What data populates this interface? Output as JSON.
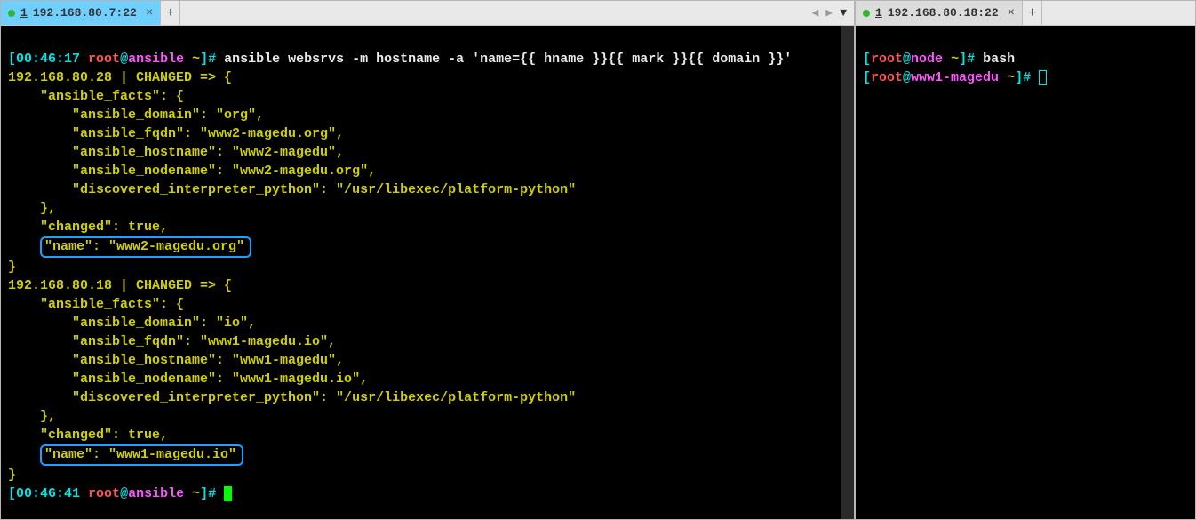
{
  "left_tab": {
    "index": "1",
    "ip": "192.168.80.7:22"
  },
  "right_tab": {
    "index": "1",
    "ip": "192.168.80.18:22"
  },
  "left": {
    "prompt1_time": "00:46:17",
    "prompt1_user": "root",
    "prompt1_at": "@",
    "prompt1_host": "ansible",
    "prompt1_path": " ~",
    "prompt1_close": "]#",
    "command": " ansible websrvs -m hostname -a 'name={{ hname }}{{ mark }}{{ domain }}'",
    "host1_header": "192.168.80.28 | CHANGED => {",
    "host1_facts_open": "    \"ansible_facts\": {",
    "host1_domain": "        \"ansible_domain\": \"org\",",
    "host1_fqdn": "        \"ansible_fqdn\": \"www2-magedu.org\",",
    "host1_hostname": "        \"ansible_hostname\": \"www2-magedu\",",
    "host1_nodename": "        \"ansible_nodename\": \"www2-magedu.org\",",
    "host1_interp": "        \"discovered_interpreter_python\": \"/usr/libexec/platform-python\"",
    "host1_facts_close": "    },",
    "host1_changed": "    \"changed\": true,",
    "host1_name": "\"name\": \"www2-magedu.org\"",
    "host1_close": "}",
    "host2_header": "192.168.80.18 | CHANGED => {",
    "host2_facts_open": "    \"ansible_facts\": {",
    "host2_domain": "        \"ansible_domain\": \"io\",",
    "host2_fqdn": "        \"ansible_fqdn\": \"www1-magedu.io\",",
    "host2_hostname": "        \"ansible_hostname\": \"www1-magedu\",",
    "host2_nodename": "        \"ansible_nodename\": \"www1-magedu.io\",",
    "host2_interp": "        \"discovered_interpreter_python\": \"/usr/libexec/platform-python\"",
    "host2_facts_close": "    },",
    "host2_changed": "    \"changed\": true,",
    "host2_name": "\"name\": \"www1-magedu.io\"",
    "host2_close": "}",
    "prompt2_time": "00:46:41",
    "prompt2_user": "root",
    "prompt2_host": "ansible",
    "prompt2_path": " ~"
  },
  "right": {
    "line1_open": "[",
    "line1_user": "root",
    "line1_at": "@",
    "line1_host": "node",
    "line1_path": " ~",
    "line1_close": "]#",
    "line1_cmd": " bash",
    "line2_open": "[",
    "line2_user": "root",
    "line2_at": "@",
    "line2_host": "www1-magedu",
    "line2_path": " ~",
    "line2_close": "]#"
  }
}
